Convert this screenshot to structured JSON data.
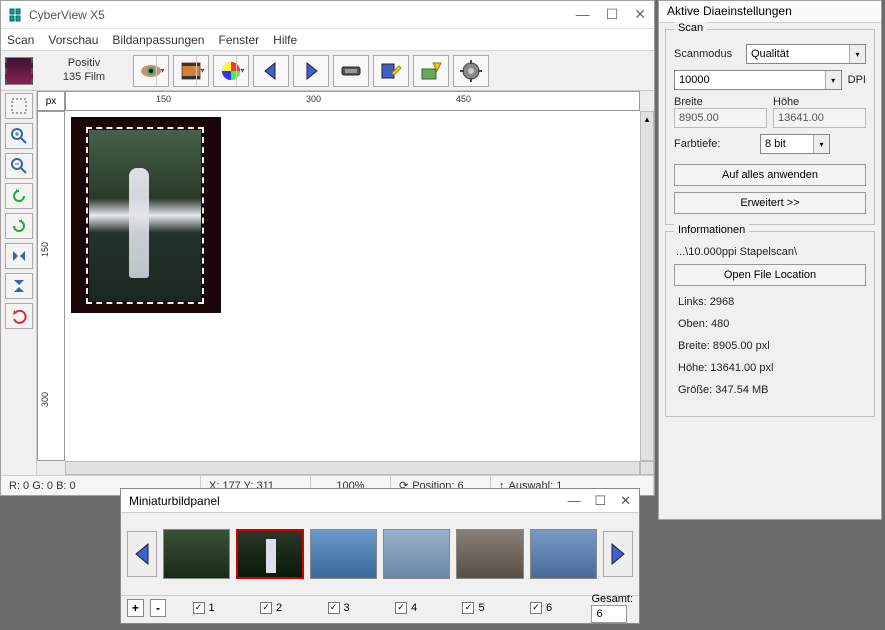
{
  "app": {
    "title": "CyberView X5"
  },
  "menu": {
    "scan": "Scan",
    "vorschau": "Vorschau",
    "bild": "Bildanpassungen",
    "fenster": "Fenster",
    "hilfe": "Hilfe"
  },
  "film": {
    "type": "Positiv",
    "format": "135 Film"
  },
  "ruler": {
    "unit": "px",
    "h": [
      "150",
      "300",
      "450"
    ],
    "v": [
      "150",
      "300"
    ]
  },
  "status": {
    "rgb": "R: 0 G: 0 B: 0",
    "xy": "X: 177 Y: 311",
    "zoom": "100%",
    "pos": "Position: 6",
    "sel": "Auswahl: 1"
  },
  "side": {
    "title": "Aktive Diaeinstellungen",
    "scan_group": "Scan",
    "scanmodus_label": "Scanmodus",
    "scanmodus_value": "Qualität",
    "dpi_value": "10000",
    "dpi_label": "DPI",
    "breite_label": "Breite",
    "hoehe_label": "Höhe",
    "breite_val": "8905.00",
    "hoehe_val": "13641.00",
    "farbtiefe_label": "Farbtiefe:",
    "farbtiefe_val": "8 bit",
    "apply_btn": "Auf alles anwenden",
    "erweitert_btn": "Erweitert >>",
    "info_group": "Informationen",
    "path": "...\\10.000ppi Stapelscan\\",
    "open_btn": "Open File Location",
    "links": "Links: 2968",
    "oben": "Oben: 480",
    "breite_info": "Breite: 8905.00 pxl",
    "hoehe_info": "Höhe: 13641.00 pxl",
    "groesse": "Größe: 347.54 MB"
  },
  "thumbs": {
    "title": "Miniaturbildpanel",
    "labels": [
      "1",
      "2",
      "3",
      "4",
      "5",
      "6"
    ],
    "gesamt_label": "Gesamt:",
    "gesamt_val": "6"
  }
}
